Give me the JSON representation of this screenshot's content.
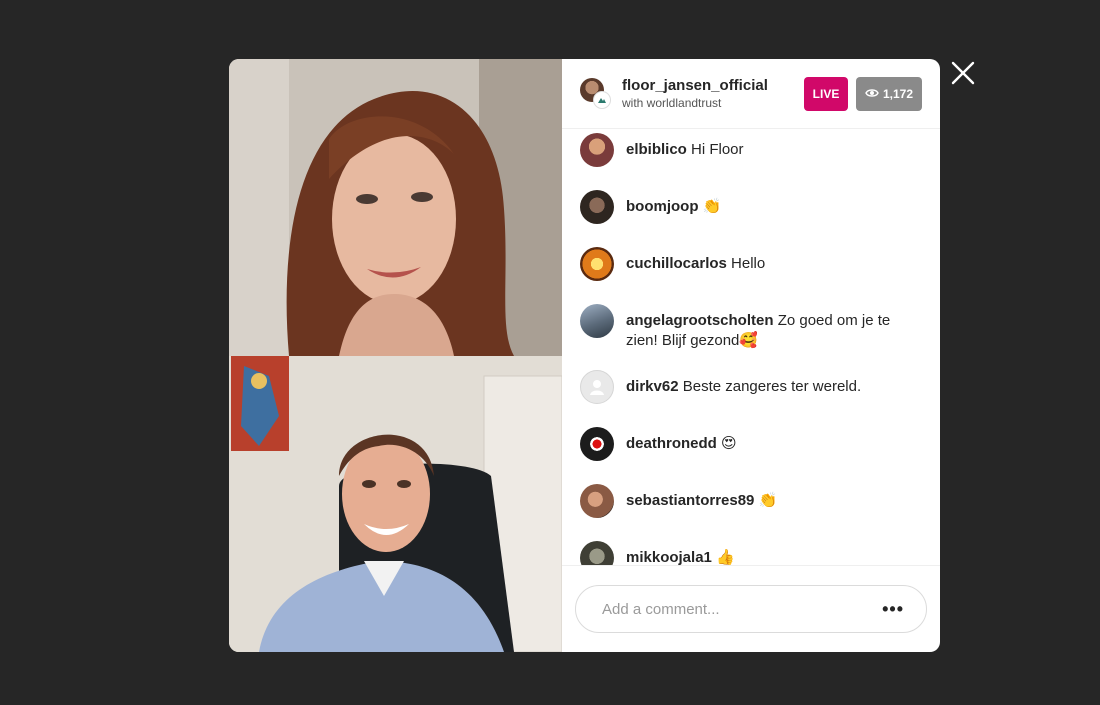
{
  "host": {
    "username": "floor_jansen_official",
    "with_text": "with worldlandtrust"
  },
  "badges": {
    "live_label": "LIVE",
    "viewer_count": "1,172"
  },
  "comments": [
    {
      "user": "elbiblico",
      "text": "Hi Floor",
      "avatar_color": "#7a3b3b"
    },
    {
      "user": "boomjoop",
      "text": "👏",
      "avatar_color": "#4a3a2e"
    },
    {
      "user": "cuchillocarlos",
      "text": "Hello",
      "avatar_color": "#c86a1c"
    },
    {
      "user": "angelagrootscholten",
      "text": "Zo goed om je te zien! Blijf gezond🥰",
      "avatar_color": "#5b6a7a"
    },
    {
      "user": "dirkv62",
      "text": "Beste zangeres ter wereld.",
      "avatar_color": "#e6e6e6"
    },
    {
      "user": "deathronedd",
      "text": "😍",
      "avatar_color": "#1c1c1c"
    },
    {
      "user": "sebastiantorres89",
      "text": "👏",
      "avatar_color": "#8a5a44"
    },
    {
      "user": "mikkoojala1",
      "text": "👍",
      "avatar_color": "#5a5a4a"
    }
  ],
  "comment_input": {
    "placeholder": "Add a comment..."
  },
  "colors": {
    "live": "#d10869",
    "viewers": "#8a8a8a",
    "backdrop": "#262626"
  }
}
